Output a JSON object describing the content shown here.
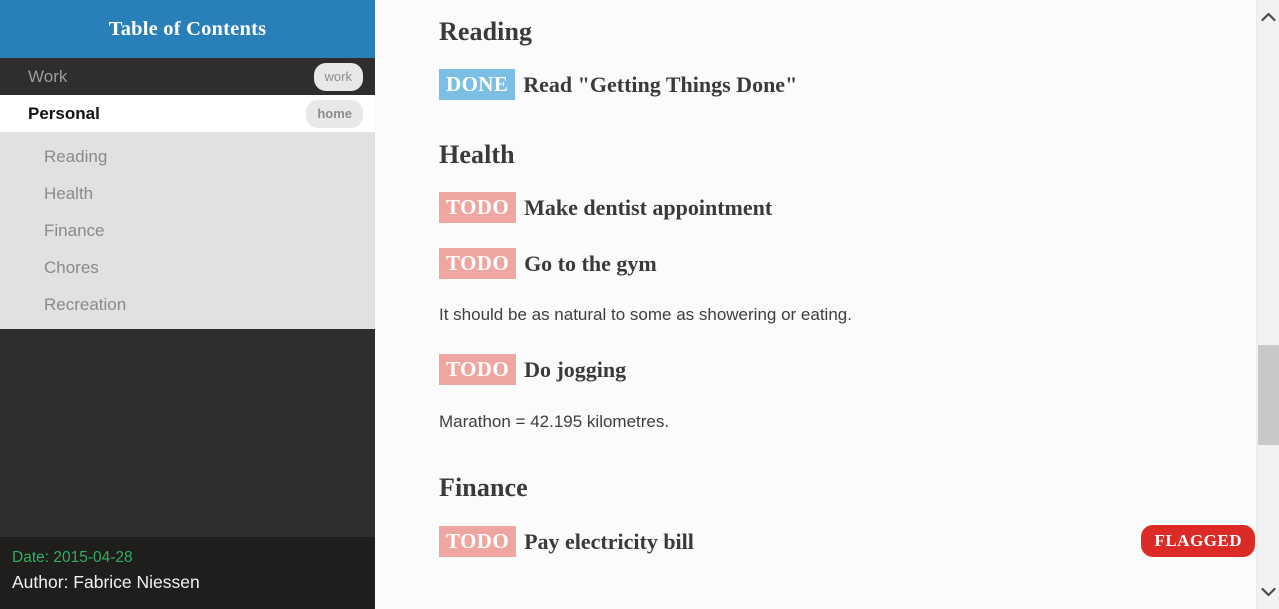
{
  "sidebar": {
    "header_title": "Table of Contents",
    "items": [
      {
        "label": "Work",
        "tag": "work",
        "level": 1,
        "active": false
      },
      {
        "label": "Personal",
        "tag": "home",
        "level": 1,
        "active": true
      }
    ],
    "subitems": [
      {
        "label": "Reading"
      },
      {
        "label": "Health"
      },
      {
        "label": "Finance"
      },
      {
        "label": "Chores"
      },
      {
        "label": "Recreation"
      }
    ],
    "footer": {
      "date": "Date: 2015-04-28",
      "author": "Author: Fabrice Niessen"
    }
  },
  "document": {
    "sections": [
      {
        "heading": "Reading",
        "task1_keyword": "DONE",
        "task1_title": "Read \"Getting Things Done\""
      },
      {
        "heading": "Health",
        "task1_keyword": "TODO",
        "task1_title": "Make dentist appointment",
        "task2_keyword": "TODO",
        "task2_title": "Go to the gym",
        "para1": "It should be as natural to some as showering or eating.",
        "task3_keyword": "TODO",
        "task3_title": "Do jogging",
        "para2": "Marathon = 42.195 kilometres."
      },
      {
        "heading": "Finance",
        "task1_keyword": "TODO",
        "task1_title": "Pay electricity bill",
        "task1_flag": "FLAGGED"
      }
    ]
  },
  "scrollbar": {
    "up_arrow": "chevron-up-icon",
    "down_arrow": "chevron-down-icon"
  },
  "colors": {
    "header_blue": "#2980b9",
    "sidebar_dark": "#2f2e2c",
    "sidebar_footer": "#1f1e1d",
    "sublist_gray": "#e1e1e1",
    "todo_salmon": "#f0a6a0",
    "done_blue": "#7cbfe5",
    "flag_red": "#dc2b26",
    "date_green": "#2eaf5f"
  }
}
